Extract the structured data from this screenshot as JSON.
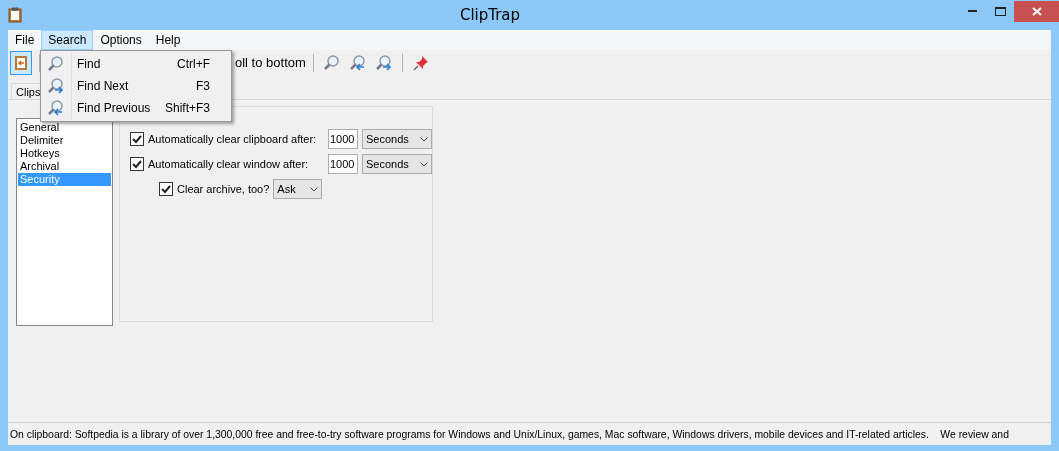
{
  "window": {
    "title": "ClipTrap"
  },
  "menu": [
    {
      "label": "File",
      "selected": false
    },
    {
      "label": "Search",
      "selected": true
    },
    {
      "label": "Options",
      "selected": false
    },
    {
      "label": "Help",
      "selected": false
    }
  ],
  "dropdown": [
    {
      "label": "Find",
      "shortcut": "Ctrl+F",
      "kind": "find"
    },
    {
      "label": "Find Next",
      "shortcut": "F3",
      "kind": "next"
    },
    {
      "label": "Find Previous",
      "shortcut": "Shift+F3",
      "kind": "previous"
    }
  ],
  "toolbar": {
    "partial_label": "oll to bottom"
  },
  "tabs": [
    {
      "label": "Clips",
      "selected": false
    }
  ],
  "categories": [
    {
      "label": "General",
      "selected": false
    },
    {
      "label": "Delimiter",
      "selected": false
    },
    {
      "label": "Hotkeys",
      "selected": false
    },
    {
      "label": "Archival",
      "selected": false
    },
    {
      "label": "Security",
      "selected": true
    }
  ],
  "settings": [
    {
      "label": "Automatically clear clipboard after:",
      "checked": true,
      "indented": false,
      "value": "1000",
      "unit": "Seconds"
    },
    {
      "label": "Automatically clear window after:",
      "checked": true,
      "indented": false,
      "value": "1000",
      "unit": "Seconds"
    },
    {
      "label": "Clear archive, too?",
      "checked": true,
      "indented": true,
      "unit": "Ask"
    }
  ],
  "status_bar": "On clipboard: Softpedia is a library of over 1,300,000 free and free-to-try software programs for Windows and Unix/Linux, games, Mac software, Windows drivers, mobile devices and IT-related articles.    We review and"
}
